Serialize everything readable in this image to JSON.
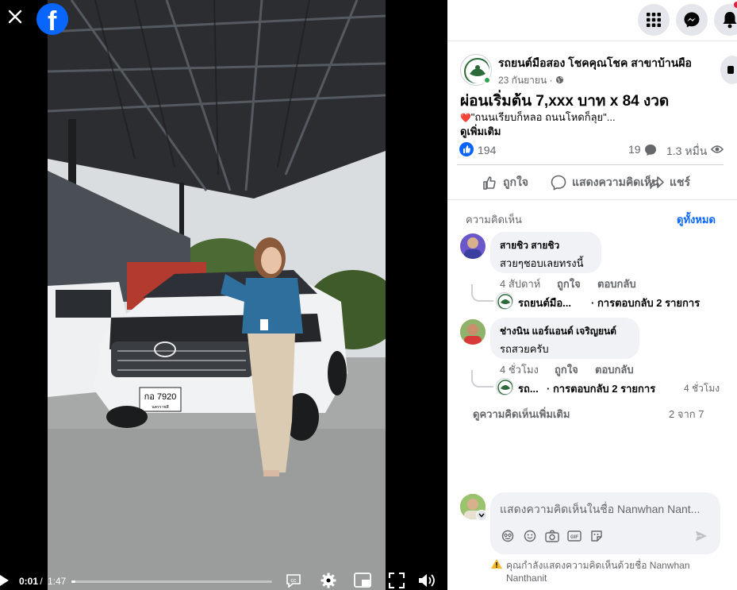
{
  "video": {
    "time_current": "0:01",
    "time_sep": " / ",
    "time_total": "1:47",
    "progress": 0.02,
    "plate_text": "กอ 7920",
    "plate_sub": "นครราชสี"
  },
  "post": {
    "page_name": "รถยนต์มือสอง โชคคุณโชค สาขาบ้านผือ",
    "date": "23 กันยายน",
    "privacy_sep": " · ",
    "title": "ผ่อนเริ่มต้น 7,xxx บาท x 84 งวด",
    "text_emoji": "❤️",
    "text": "\"ถนนเรียบก็หลอ ถนนโหดก็ลุย\"...",
    "see_more": "ดูเพิ่มเติม",
    "like_count": "194",
    "comment_count": "19",
    "view_count": "1.3 หมื่น"
  },
  "actions": {
    "like": "ถูกใจ",
    "comment": "แสดงความคิดเห็น",
    "share": "แชร์"
  },
  "comments_section": {
    "label": "ความคิดเห็น",
    "see_all": "ดูทั้งหมด",
    "items": [
      {
        "author": "สายชิว สายชิว",
        "text": "สวยๆชอบเลยทรงนี้",
        "time": "4 สัปดาห์",
        "like": "ถูกใจ",
        "reply": "ตอบกลับ",
        "reply_author": "รถยนต์มือ...",
        "reply_summary": "· การตอบกลับ 2 รายการ",
        "reply_time": ""
      },
      {
        "author": "ช่างนิน แอร์แอนด์ เจริญยนต์",
        "text": "รถสวยครับ",
        "time": "4 ชั่วโมง",
        "like": "ถูกใจ",
        "reply": "ตอบกลับ",
        "reply_author": "รถ...",
        "reply_summary": "· การตอบกลับ 2 รายการ",
        "reply_time": "4 ชั่วโมง"
      }
    ],
    "more": "ดูความคิดเห็นเพิ่มเติม",
    "pagination": "2 จาก 7"
  },
  "composer": {
    "placeholder": "แสดงความคิดเห็นในชื่อ Nanwhan Nant...",
    "warning_line1": "คุณกำลังแสดงความคิดเห็นด้วยชื่อ Nanwhan",
    "warning_line2": "Nanthanit"
  },
  "colors": {
    "brand": "#0866ff",
    "muted": "#65676b",
    "bubble": "#f0f2f5",
    "notification": "#e41e3f"
  },
  "icons": [
    "close-icon",
    "facebook-logo-icon",
    "menu-grid-icon",
    "messenger-icon",
    "bell-icon",
    "play-icon",
    "captions-icon",
    "settings-icon",
    "pip-icon",
    "fullscreen-icon",
    "volume-icon",
    "globe-icon",
    "like-reaction-icon",
    "comment-bubble-icon",
    "eye-icon",
    "thumb-up-icon",
    "comment-icon",
    "share-icon",
    "sticker-icon",
    "emoji-icon",
    "camera-icon",
    "gif-icon",
    "sticker-add-icon",
    "send-icon",
    "warning-icon"
  ]
}
